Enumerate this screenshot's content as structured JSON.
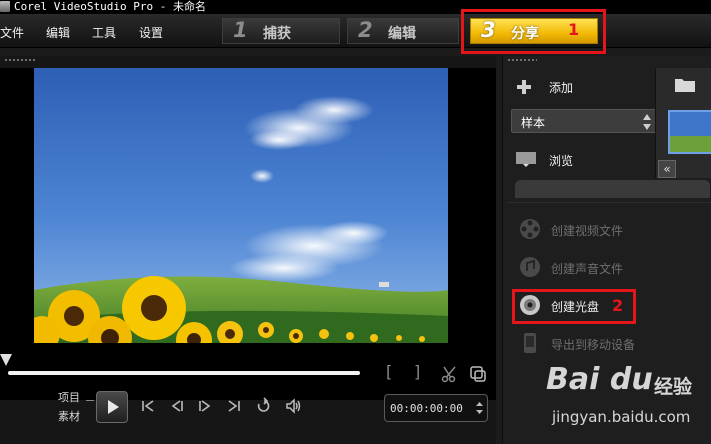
{
  "window": {
    "title": "Corel VideoStudio Pro - 未命名"
  },
  "menu": [
    {
      "label": "文件"
    },
    {
      "label": "编辑"
    },
    {
      "label": "工具"
    },
    {
      "label": "设置"
    }
  ],
  "steps": [
    {
      "num": "1",
      "label": "捕获"
    },
    {
      "num": "2",
      "label": "编辑"
    },
    {
      "num": "3",
      "label": "分享",
      "active": true
    }
  ],
  "annotations": {
    "step_marker": "1",
    "disc_marker": "2",
    "color": "#e4161b"
  },
  "preview": {
    "mode_project": "项目",
    "mode_clip": "素材",
    "timecode": "00:00:00:00",
    "mark_in": "[",
    "mark_out": "]"
  },
  "library": {
    "add_label": "添加",
    "sample_label": "样本",
    "browse_label": "浏览"
  },
  "share_options": [
    {
      "label": "创建视频文件",
      "icon": "film-reel-icon",
      "enabled": false
    },
    {
      "label": "创建声音文件",
      "icon": "audio-disc-icon",
      "enabled": false
    },
    {
      "label": "创建光盘",
      "icon": "disc-icon",
      "enabled": true
    },
    {
      "label": "导出到移动设备",
      "icon": "mobile-device-icon",
      "enabled": false
    }
  ],
  "watermark": {
    "logo": "Bai du",
    "brand": "经验",
    "url": "jingyan.baidu.com"
  },
  "colors": {
    "active_step": "#f2ba06",
    "annotation": "#e4161b",
    "sky": "#3f75c9"
  }
}
